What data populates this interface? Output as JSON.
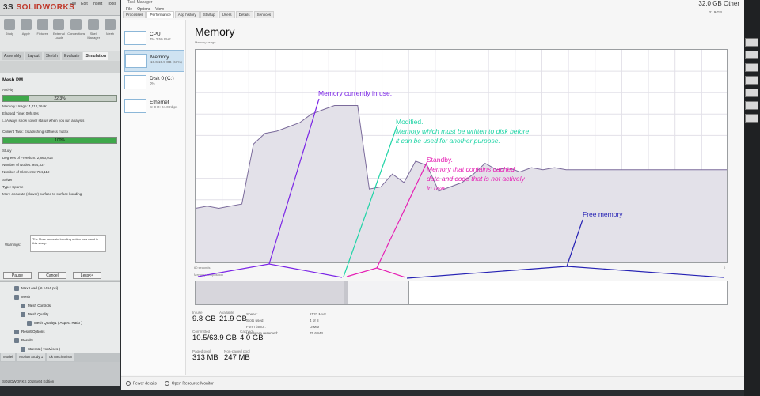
{
  "solidworks": {
    "logo_prefix": "3S",
    "logo": "SOLIDWORKS",
    "menu": [
      "File",
      "Edit",
      "Insert",
      "Tools"
    ],
    "ribbon": [
      "Study",
      "Apply",
      "Fixtures",
      "External Loads",
      "Connections",
      "Shell Manager",
      "Mesh"
    ],
    "tabs": [
      "Assembly",
      "Layout",
      "Sketch",
      "Evaluate",
      "Simulation"
    ],
    "active_tab": "Simulation",
    "dialog_title": "Mesh PM",
    "activity_label": "Activity",
    "progress_value": 0.223,
    "progress_text": "22.3%",
    "memory_usage": "Memory Usage: 4,412,264K",
    "elapsed_time": "Elapsed Time: 00h:40s",
    "always_show": "Always show solver status when you run analysis",
    "current_task": "Current Task: Establishing stiffness matrix",
    "task_progress_value": 1.0,
    "task_progress_text": "100%",
    "study_label": "Study",
    "dof": "Degrees of Freedom: 2,863,013",
    "nodes": "Number of Nodes: 954,337",
    "elements": "Number of Elements: 784,119",
    "solver_label": "Solver",
    "solver_type": "Type: Sparse",
    "solver_note": "More accurate (slower) surface to surface bonding",
    "warnings_label": "Warnings:",
    "warning_text": "The More accurate bonding option was used in this study.",
    "pause": "Pause",
    "cancel": "Cancel",
    "less": "Less<<",
    "tree": [
      "Max Load (-6 1454 psi)",
      "Mesh",
      "Mesh Controls",
      "Mesh Quality",
      "Mesh Quality1 ( Aspect Ratio )",
      "Result Options",
      "Results",
      "Stress1 ( vonMises )"
    ],
    "bottom_tabs": [
      "Model",
      "Motion Study 1",
      "Lk Mechanism"
    ],
    "status_text": "SOLIDWORKS 2018 x64 Edition"
  },
  "taskmanager": {
    "title": "Task Manager",
    "menu": [
      "File",
      "Options",
      "View"
    ],
    "tabs": [
      "Processes",
      "Performance",
      "App history",
      "Startup",
      "Users",
      "Details",
      "Services"
    ],
    "active_tab": "Performance",
    "sidebar": [
      {
        "name": "CPU",
        "sub": "7% 2.50 GHz"
      },
      {
        "name": "Memory",
        "sub": "10.0/15.9 GB (61%)"
      },
      {
        "name": "Disk 0 (C:)",
        "sub": "0%"
      },
      {
        "name": "Ethernet",
        "sub": "S: 0 R: 24.0 Kbps"
      }
    ],
    "active_sidebar": "Memory",
    "heading": "Memory",
    "subheading": "Memory usage",
    "total_label": "32.0 GB Other",
    "total_small": "31.9 GB",
    "graph_time": "60 seconds",
    "graph_zero": "0",
    "composition_label": "Memory composition",
    "graph_series": [
      0.26,
      0.27,
      0.26,
      0.27,
      0.28,
      0.56,
      0.61,
      0.62,
      0.64,
      0.66,
      0.7,
      0.72,
      0.74,
      0.74,
      0.74,
      0.35,
      0.36,
      0.42,
      0.38,
      0.48,
      0.46,
      0.34,
      0.36,
      0.38,
      0.42,
      0.47,
      0.44,
      0.45,
      0.43,
      0.45,
      0.44,
      0.45,
      0.44,
      0.44,
      0.44,
      0.44,
      0.44,
      0.44,
      0.44,
      0.44,
      0.44,
      0.44,
      0.44,
      0.44,
      0.44,
      0.44,
      0.44
    ],
    "composition": {
      "in_use": 0.28,
      "modified": 0.008,
      "standby": 0.115,
      "free": 0.597
    },
    "stats": {
      "in_use_label": "In use",
      "in_use": "9.8 GB",
      "available_label": "Available",
      "available": "21.9 GB",
      "committed_label": "Committed",
      "committed": "10.5/63.9 GB",
      "cached_label": "Cached",
      "cached": "4.0 GB",
      "paged_label": "Paged pool",
      "paged": "313 MB",
      "nonpaged_label": "Non-paged pool",
      "nonpaged": "247 MB"
    },
    "specs": [
      {
        "k": "Speed:",
        "v": "2133 MHz"
      },
      {
        "k": "Slots used:",
        "v": "4 of 8"
      },
      {
        "k": "Form factor:",
        "v": "DIMM"
      },
      {
        "k": "Hardware reserved:",
        "v": "75.6 MB"
      }
    ],
    "footer_fewer": "Fewer details",
    "footer_monitor": "Open Resource Monitor"
  },
  "annotations": {
    "in_use": "Memory currently in use.",
    "modified_title": "Modified.",
    "modified_body_1": "Memory which must be written to disk before",
    "modified_body_2": "it can be used for another purpose.",
    "standby_title": "Standby.",
    "standby_body_1": "Memory that contains cached",
    "standby_body_2": "data and code that is not actively",
    "standby_body_3": "in use.",
    "free": "Free memory",
    "colors": {
      "in_use": "#7a24e6",
      "modified": "#1fd4a6",
      "standby": "#e61fb4",
      "free": "#2622b4"
    }
  }
}
